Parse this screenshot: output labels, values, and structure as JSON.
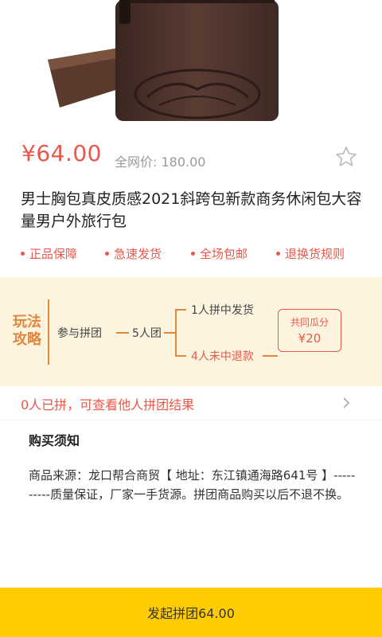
{
  "product": {
    "price": "¥64.00",
    "market_price": "全网价: 180.00",
    "title": "男士胸包真皮质感2021斜跨包新款商务休闲包大容量男户外旅行包"
  },
  "services": [
    {
      "label": "正品保障"
    },
    {
      "label": "急速发货"
    },
    {
      "label": "全场包邮"
    },
    {
      "label": "退换货规则"
    }
  ],
  "guide": {
    "title": "玩法攻略",
    "step_join": "参与拼团",
    "step_size": "5人团",
    "win": "1人拼中发货",
    "lose": "4人未中退款",
    "share_label": "共同瓜分",
    "share_value": "¥20"
  },
  "group_status": "0人已拼，可查看他人拼团结果",
  "notice": {
    "title": "购买须知",
    "body": "商品来源：龙口帮合商贸【 地址：东江镇通海路641号 】----------质量保证，厂家一手货源。拼团商品购买以后不退不换。"
  },
  "launch_button": "发起拼团64.00",
  "colors": {
    "accent_red": "#e8584a",
    "guide_bg": "#fdf4df",
    "guide_orange": "#e0873b",
    "button_yellow": "#ffcc00"
  }
}
